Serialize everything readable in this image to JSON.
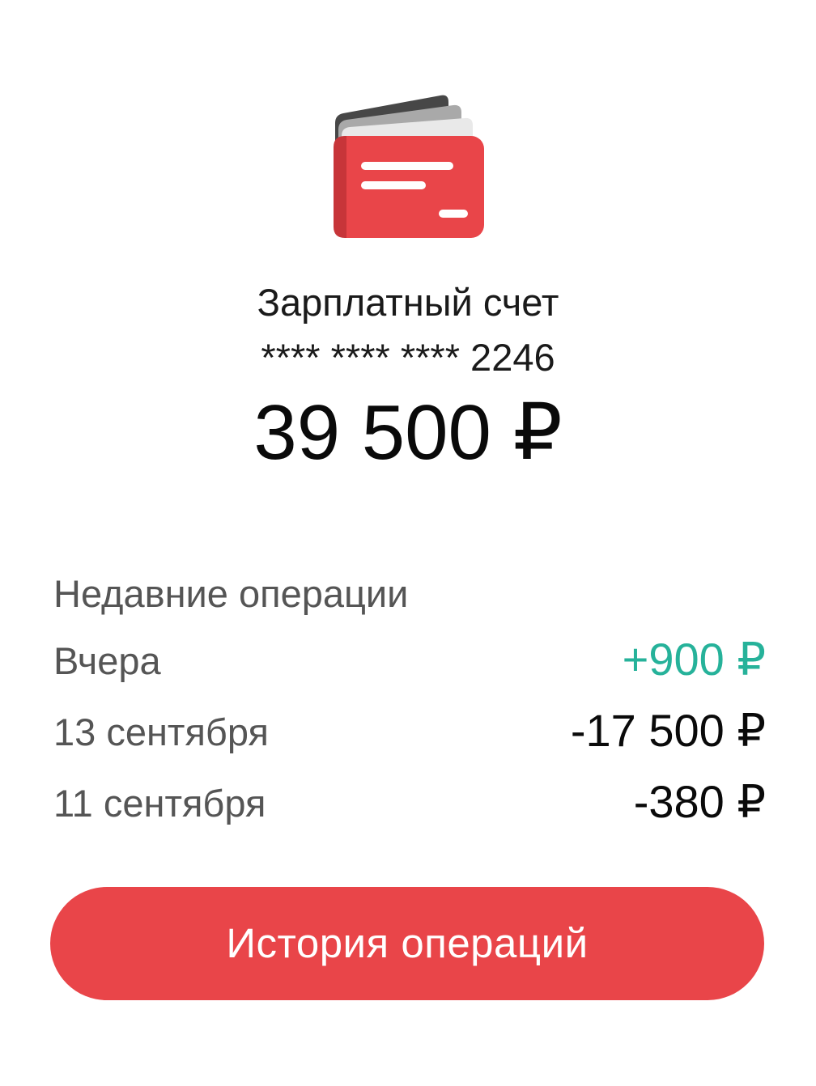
{
  "account": {
    "icon": "wallet-icon",
    "name": "Зарплатный счет",
    "number": "**** **** **** 2246",
    "balance": "39 500 ₽"
  },
  "recent": {
    "title": "Недавние операции",
    "operations": [
      {
        "date": "Вчера",
        "amount": "+900 ₽",
        "type": "income"
      },
      {
        "date": "13 сентября",
        "amount": "-17 500 ₽",
        "type": "expense"
      },
      {
        "date": "11 сентября",
        "amount": "-380 ₽",
        "type": "expense"
      }
    ]
  },
  "actions": {
    "history_label": "История операций"
  },
  "colors": {
    "accent": "#e94549",
    "income": "#26b29a",
    "muted_text": "#555555"
  }
}
